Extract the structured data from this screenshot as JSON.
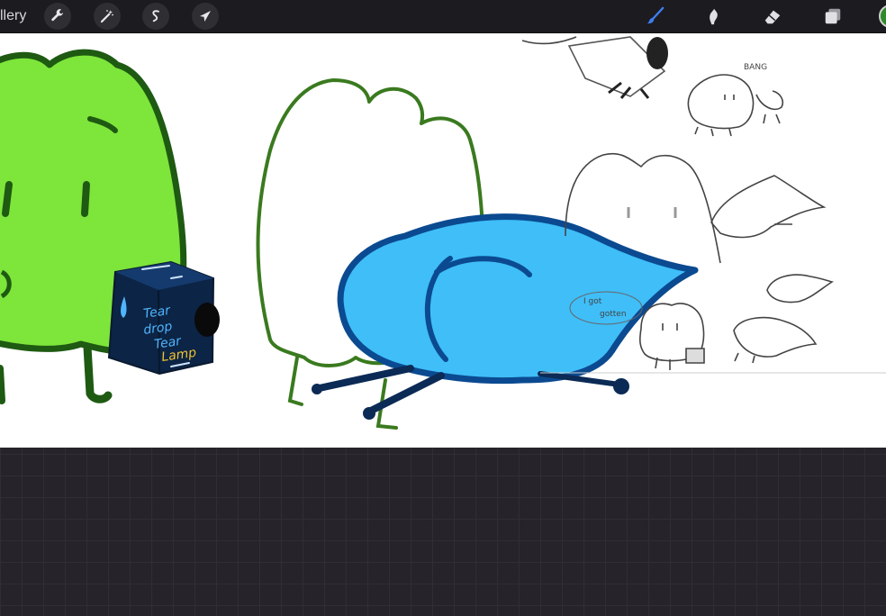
{
  "app": {
    "gallery_label": "llery"
  },
  "toolbar_left": [
    {
      "name": "actions-wrench-icon"
    },
    {
      "name": "adjustments-magic-wand-icon"
    },
    {
      "name": "selection-s-icon"
    },
    {
      "name": "transform-arrow-icon"
    }
  ],
  "toolbar_right": [
    {
      "name": "brush-icon"
    },
    {
      "name": "smudge-icon"
    },
    {
      "name": "eraser-icon"
    },
    {
      "name": "layers-icon"
    }
  ],
  "colors": {
    "brush_active": "#3d7df0",
    "current_color": "#2f8a2a",
    "toolbar_bg": "#1c1b1f",
    "canvas_bg": "#ffffff",
    "workspace_bg": "#26242a"
  },
  "artwork": {
    "box_label_line1": "Tear",
    "box_label_line2": "drop",
    "box_label_line3": "Tear",
    "box_label_line4": "Lamp",
    "sketch_label_1": "BANG",
    "sketch_label_2": "I got",
    "sketch_label_3": "gotten"
  }
}
